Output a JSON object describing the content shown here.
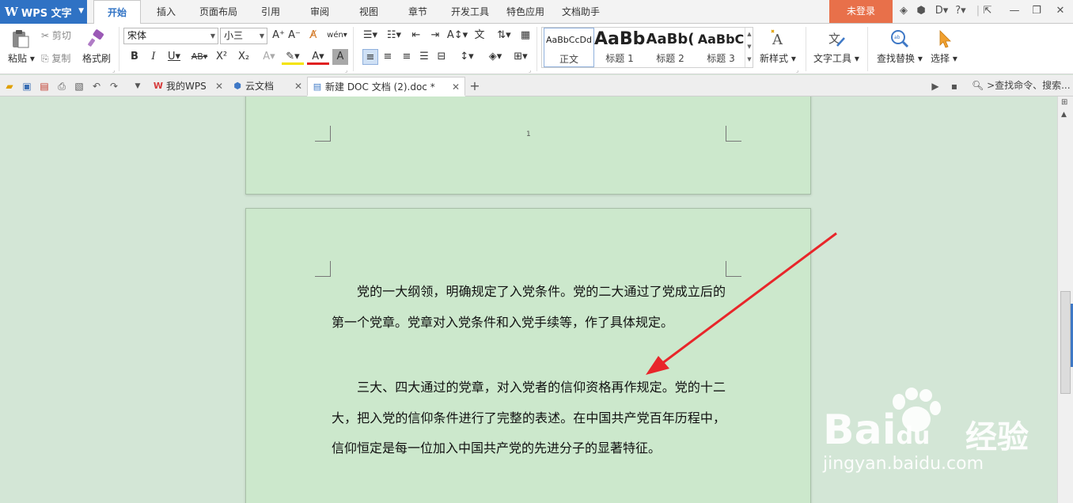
{
  "app": {
    "name": "WPS 文字"
  },
  "menu": {
    "tabs": [
      "开始",
      "插入",
      "页面布局",
      "引用",
      "审阅",
      "视图",
      "章节",
      "开发工具",
      "特色应用",
      "文档助手"
    ],
    "login": "未登录"
  },
  "ribbon": {
    "paste": "粘贴",
    "cut": "剪切",
    "copy": "复制",
    "format_painter": "格式刷",
    "font_name": "宋体",
    "font_size": "小三",
    "styles": [
      {
        "sample": "AaBbCcDd",
        "name": "正文"
      },
      {
        "sample": "AaBb",
        "name": "标题 1"
      },
      {
        "sample": "AaBb(",
        "name": "标题 2"
      },
      {
        "sample": "AaBbC",
        "name": "标题 3"
      }
    ],
    "new_style": "新样式",
    "text_tools": "文字工具",
    "find_replace": "查找替换",
    "select": "选择"
  },
  "tabs": {
    "my_wps": "我的WPS",
    "cloud_docs": "云文档",
    "active_doc": "新建 DOC 文档 (2).doc *",
    "search_cmd": ">查找命令、搜索..."
  },
  "document": {
    "page_number": "1",
    "paragraphs": [
      "党的一大纲领，明确规定了入党条件。党的二大通过了党成立后的第一个党章。党章对入党条件和入党手续等，作了具体规定。",
      "三大、四大通过的党章，对入党者的信仰资格再作规定。党的十二大，把入党的信仰条件进行了完整的表述。在中国共产党百年历程中，信仰恒定是每一位加入中国共产党的先进分子的显著特征。"
    ]
  },
  "colors": {
    "accent": "#2f72c4",
    "login_bg": "#e8704a",
    "page_bg": "#cce8cc",
    "annotation": "#e8262a"
  },
  "watermark": {
    "brand": "Bai",
    "brand_tail": "du",
    "cn": "经验",
    "url": "jingyan.baidu.com"
  }
}
